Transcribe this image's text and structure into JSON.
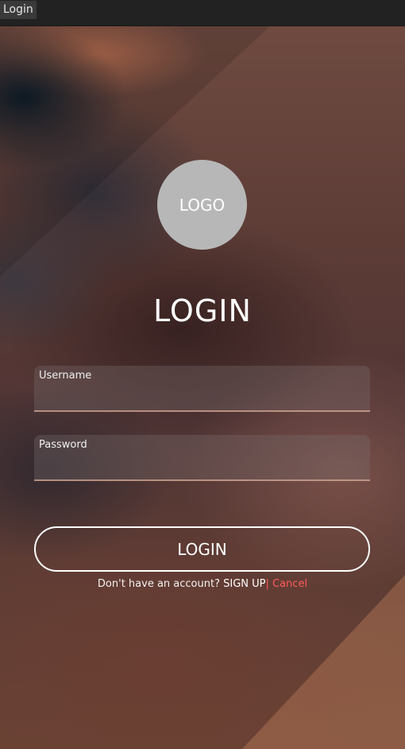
{
  "window": {
    "title": "Login"
  },
  "logo": {
    "text": "LOGO"
  },
  "form": {
    "heading": "LOGIN",
    "username": {
      "label": "Username",
      "value": "",
      "placeholder": ""
    },
    "password": {
      "label": "Password",
      "value": "",
      "placeholder": ""
    },
    "submit_label": "LOGIN"
  },
  "footer": {
    "prompt": "Don't have an account? ",
    "signup_label": "SIGN UP",
    "cancel_label": "| Cancel"
  },
  "colors": {
    "cancel": "#ff5a5a",
    "logo_circle": "#b7b7b7",
    "field_underline": "#d7aa96"
  }
}
